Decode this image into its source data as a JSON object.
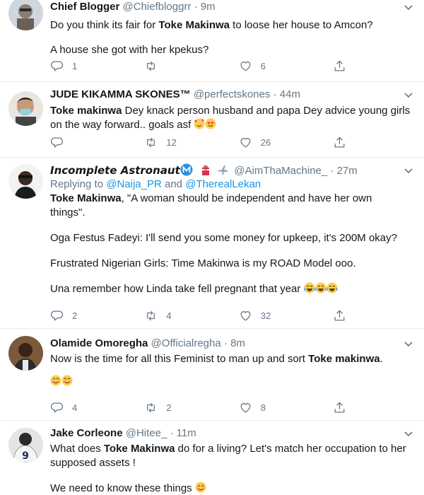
{
  "tweets": [
    {
      "name": "Chief Blogger",
      "handle": "@Chiefbloggrr",
      "separator": "·",
      "time": "9m",
      "line1_pre": "Do you think its fair for ",
      "line1_bold": "Toke Makinwa",
      "line1_post": " to loose her house to Amcon?",
      "line2": "A house she got with her kpekus?",
      "replies": "1",
      "retweets": "",
      "likes": "6"
    },
    {
      "name": "JUDE KIKAMMA SKONES™",
      "handle": "@perfectskones",
      "separator": "·",
      "time": "44m",
      "line1_bold": "Toke makinwa",
      "line1_post": " Dey knack person husband and papa Dey advice young girls",
      "line2": "on the way forward.. goals asf",
      "replies": "",
      "retweets": "12",
      "likes": "26"
    },
    {
      "name": "Incomplete Astronaut",
      "handle": "@AimThaMachine_",
      "separator": "·",
      "time": "27m",
      "reply_prefix": "Replying to ",
      "reply_user1": "@Naija_PR",
      "reply_and": " and ",
      "reply_user2": "@TherealLekan",
      "line1_bold": "Toke Makinwa",
      "line1_post": ", \"A woman should be independent and have her own",
      "line2": "things\".",
      "line3": "Oga Festus Fadeyi: I'll send you some money for upkeep, it's 200M okay?",
      "line4": "Frustrated Nigerian Girls: Time Makinwa is my ROAD Model ooo.",
      "line5": "Una remember how Linda take fell pregnant that year",
      "replies": "2",
      "retweets": "4",
      "likes": "32"
    },
    {
      "name": "Olamide Omoregha",
      "handle": "@Officialregha",
      "separator": "·",
      "time": "8m",
      "line1_pre": "Now is the time for all this Feminist to man up and sort ",
      "line1_bold": "Toke makinwa",
      "line1_post": ".",
      "replies": "4",
      "retweets": "2",
      "likes": "8"
    },
    {
      "name": "Jake Corleone",
      "handle": "@Hitee_",
      "separator": "·",
      "time": "11m",
      "line1_pre": "What does ",
      "line1_bold": "Toke Makinwa",
      "line1_post": " do for a living? Let's match her occupation to her",
      "line2": "supposed assets !",
      "line3": "We need to know these things"
    }
  ],
  "colors": {
    "text": "#14171a",
    "secondary": "#657786",
    "link": "#1b95e0",
    "divider": "#e6ecf0"
  },
  "icons": [
    "reply-icon",
    "retweet-icon",
    "like-icon",
    "share-icon",
    "caret-down-icon"
  ]
}
